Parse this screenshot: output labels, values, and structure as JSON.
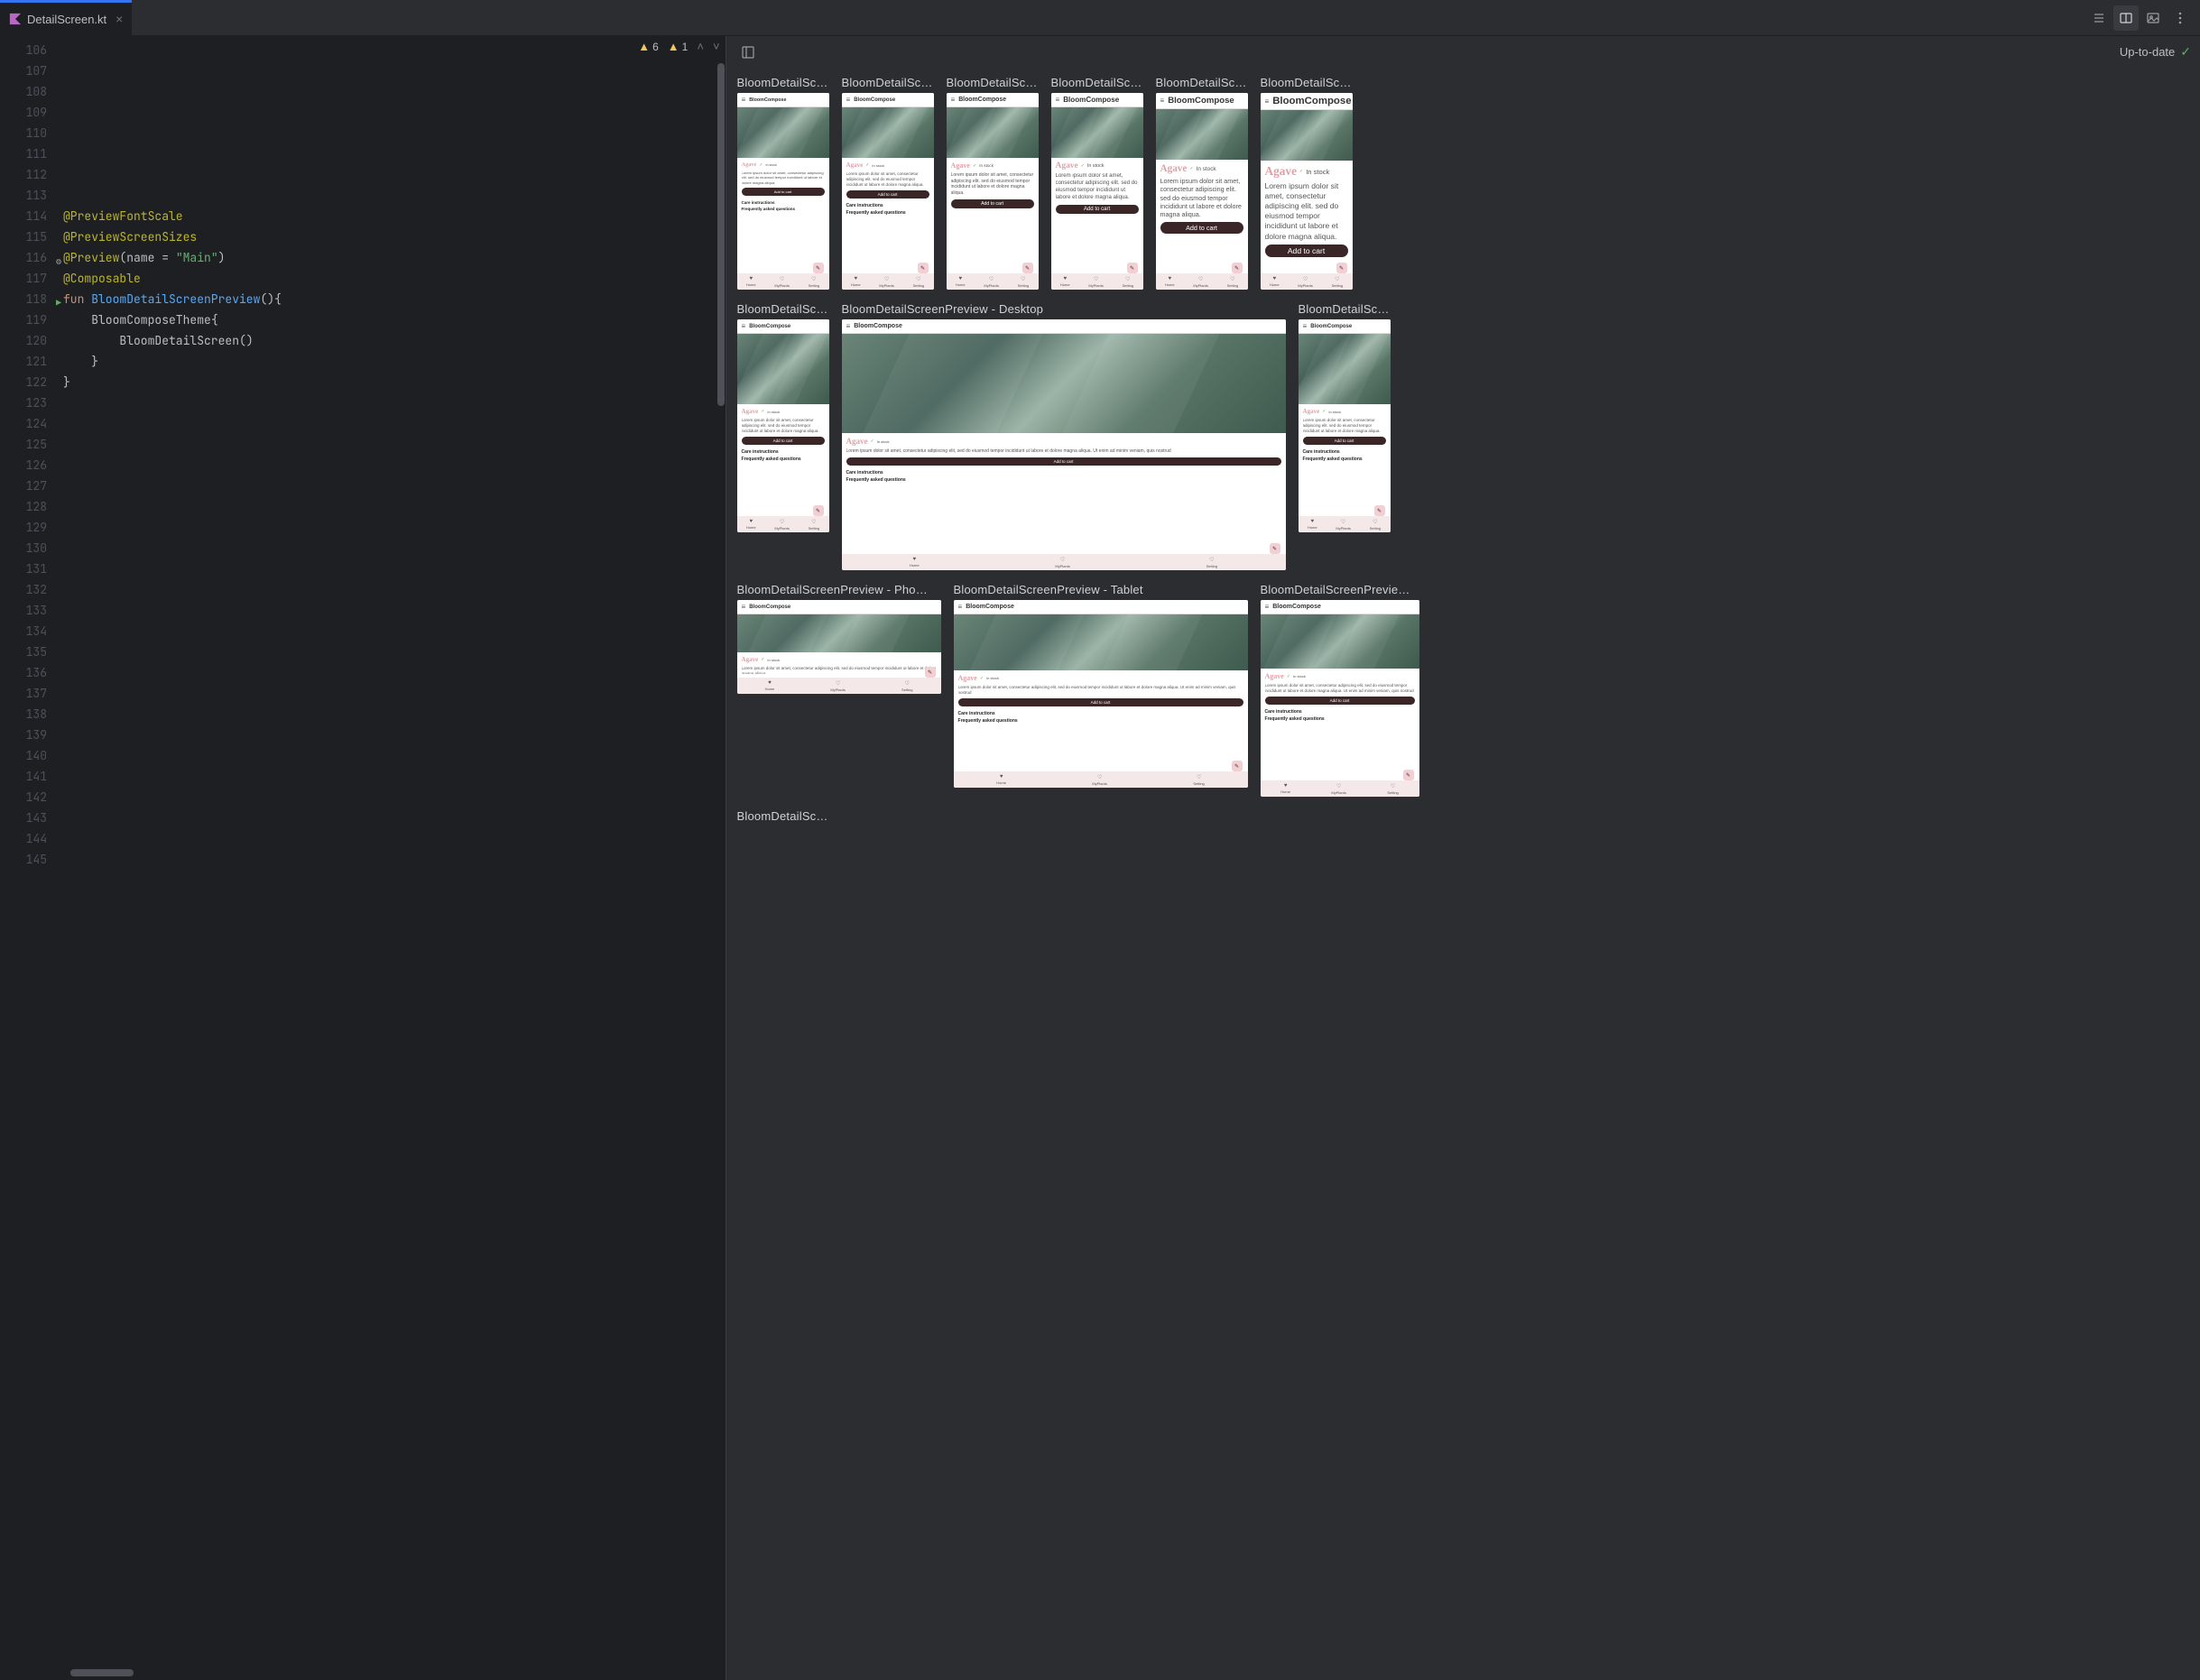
{
  "tab": {
    "filename": "DetailScreen.kt"
  },
  "editor": {
    "warnings": {
      "high": "6",
      "med": "1"
    },
    "lines_start": 106,
    "lines_end": 145,
    "code": {
      "l114": "@PreviewFontScale",
      "l115": "@PreviewScreenSizes",
      "l116_ann": "@Preview",
      "l116_arg_name": "name = ",
      "l116_str": "\"Main\"",
      "l117": "@Composable",
      "l118_fun": "fun ",
      "l118_name": "BloomDetailScreenPreview",
      "l118_tail": "(){",
      "l119": "BloomComposeTheme",
      "l119_tail": "{",
      "l120": "BloomDetailScreen",
      "l120_tail": "()",
      "l121": "}",
      "l122": "}"
    },
    "gutter_icons": {
      "116": "gear",
      "118": "run"
    }
  },
  "preview": {
    "status": "Up-to-date",
    "app_title": "BloomCompose",
    "plant": "Agave",
    "stock_label": "In stock",
    "add_to_cart": "Add to cart",
    "care": "Care instructions",
    "faq": "Frequently asked questions",
    "lorem_short": "Lorem ipsum dolor sit amet, consectetur adipiscing elit. sed do eiusmod tempor incididunt ut labore et dolore magna aliqua.",
    "lorem_long": "Lorem ipsum dolor sit amet, consectetur adipiscing elit, sed do eiusmod tempor incididunt ut labore et dolore magna aliqua. Ut enim ad minim veniam, quis nostrud",
    "nav": {
      "home": "Home",
      "myplants": "MyPlants",
      "setting": "Setting"
    },
    "items_row1": [
      {
        "title": "BloomDetailSc…",
        "size": "sm"
      },
      {
        "title": "BloomDetailSc…",
        "size": "sm"
      },
      {
        "title": "BloomDetailSc…",
        "size": "sm"
      },
      {
        "title": "BloomDetailSc…",
        "size": "sm"
      },
      {
        "title": "BloomDetailSc…",
        "size": "sm"
      },
      {
        "title": "BloomDetailSc…",
        "size": "sm"
      }
    ],
    "items_row2": [
      {
        "title": "BloomDetailSc…",
        "size": "md"
      },
      {
        "title": "BloomDetailScreenPreview - Desktop",
        "size": "xl"
      },
      {
        "title": "BloomDetailSc…",
        "size": "md"
      }
    ],
    "items_row3": [
      {
        "title": "BloomDetailScreenPreview - Pho…",
        "size": "phone-land"
      },
      {
        "title": "BloomDetailScreenPreview - Tablet",
        "size": "tablet"
      },
      {
        "title": "BloomDetailScreenPrevie…",
        "size": "fold"
      }
    ],
    "items_row4": [
      {
        "title": "BloomDetailSc…"
      }
    ]
  }
}
